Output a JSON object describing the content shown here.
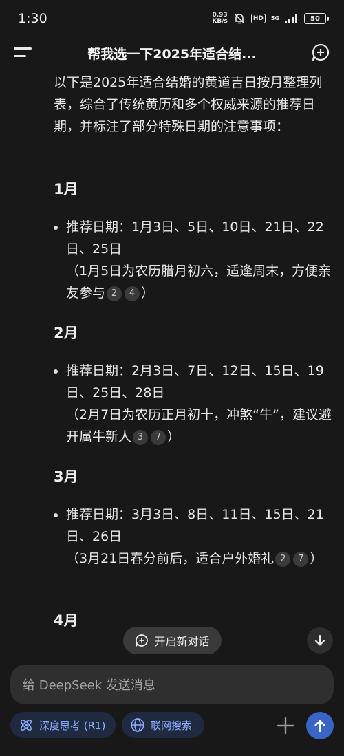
{
  "status_bar": {
    "time": "1:30",
    "speed_value": "0.93",
    "speed_unit": "KB/s",
    "hd": "HD",
    "network": "5G",
    "battery": "50"
  },
  "header": {
    "title": "帮我选一下2025年适合结...",
    "icons": [
      "menu-icon",
      "new-chat-icon"
    ]
  },
  "intro": "以下是2025年适合结婚的黄道吉日按月整理列表，综合了传统黄历和多个权威来源的推荐日期，并标注了部分特殊日期的注意事项：",
  "months": [
    {
      "title": "1月",
      "dates": "推荐日期：1月3日、5日、10日、21日、22日、25日",
      "note": "（1月5日为农历腊月初六，适逢周末，方便亲友参与",
      "citations": [
        "2",
        "4"
      ],
      "note_end": "）"
    },
    {
      "title": "2月",
      "dates": "推荐日期：2月3日、7日、12日、15日、19日、25日、28日",
      "note": "（2月7日为农历正月初十，冲煞“牛”，建议避开属牛新人",
      "citations": [
        "3",
        "7"
      ],
      "note_end": "）"
    },
    {
      "title": "3月",
      "dates": "推荐日期：3月3日、8日、11日、15日、21日、26日",
      "note": "（3月21日春分前后，适合户外婚礼",
      "citations": [
        "2",
        "7"
      ],
      "note_end": "）"
    },
    {
      "title": "4月"
    }
  ],
  "floating": {
    "new_chat_label": "开启新对话"
  },
  "composer": {
    "placeholder": "给 DeepSeek 发送消息",
    "deep_think_label": "深度思考 (R1)",
    "web_search_label": "联网搜索"
  },
  "colors": {
    "background": "#181818",
    "accent": "#3a65c8",
    "tool_text": "#8fb0ff"
  }
}
